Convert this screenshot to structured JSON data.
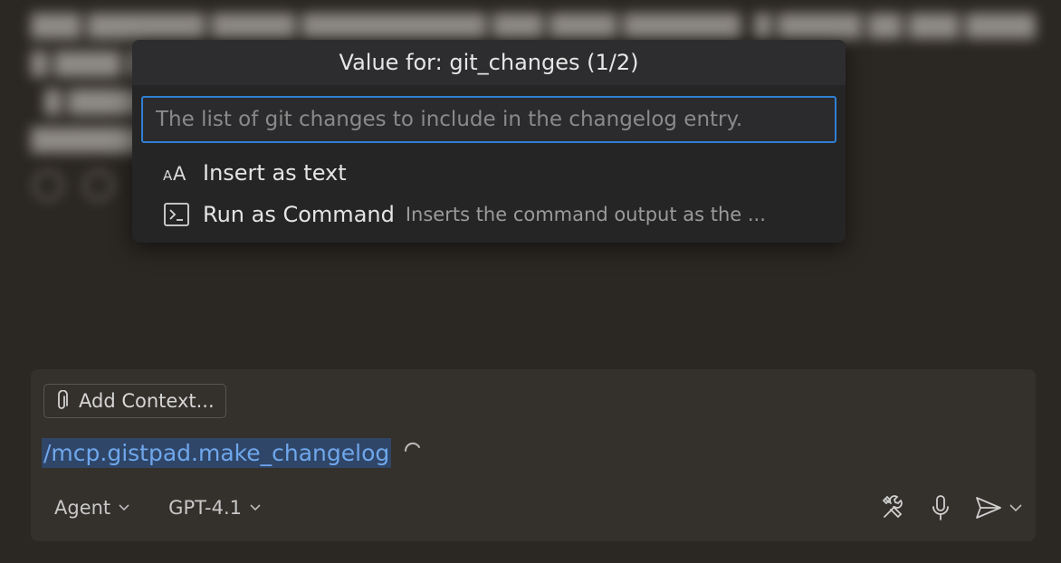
{
  "quick_pick": {
    "title": "Value for: git_changes (1/2)",
    "input_placeholder": "The list of git changes to include in the changelog entry.",
    "items": [
      {
        "icon": "text-size-icon",
        "label": "Insert as text",
        "description": ""
      },
      {
        "icon": "terminal-icon",
        "label": "Run as Command",
        "description": "Inserts the command output as the ..."
      }
    ]
  },
  "chat_input": {
    "add_context_label": "Add Context...",
    "command_text": "/mcp.gistpad.make_changelog",
    "mode_label": "Agent",
    "model_label": "GPT-4.1"
  },
  "colors": {
    "accent": "#2f7fd3",
    "command_text": "#6fa7ec",
    "background": "#2b2723"
  }
}
